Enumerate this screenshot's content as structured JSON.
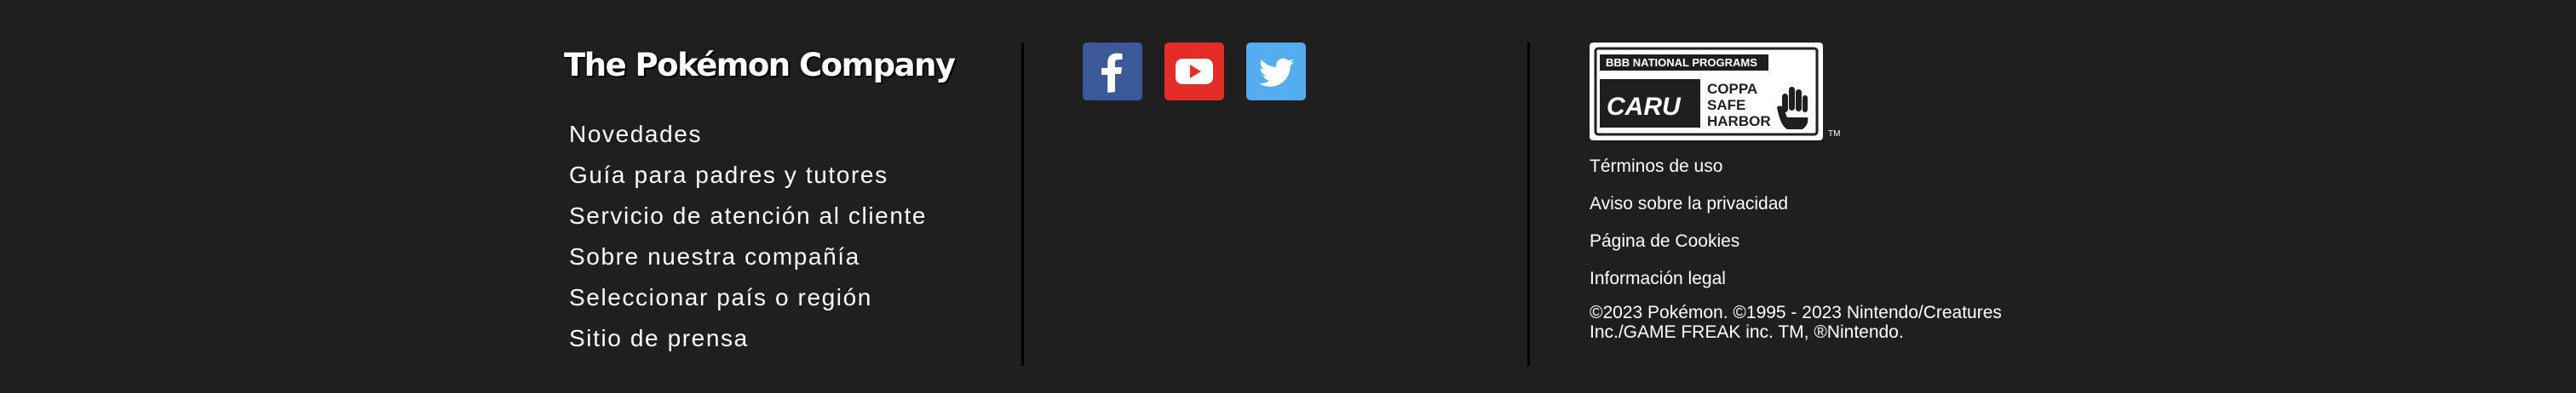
{
  "brand": {
    "name": "The Pokémon Company"
  },
  "nav": {
    "items": [
      "Novedades",
      "Guía para padres y tutores",
      "Servicio de atención al cliente",
      "Sobre nuestra compañía",
      "Seleccionar país o región",
      "Sitio de prensa"
    ]
  },
  "social": {
    "icons": [
      "facebook-icon",
      "youtube-icon",
      "twitter-icon"
    ],
    "colors": {
      "facebook": "#3b5998",
      "youtube": "#e52d27",
      "twitter": "#55acee"
    }
  },
  "badge": {
    "top_text": "BBB NATIONAL PROGRAMS",
    "caru": "CARU",
    "line1": "COPPA",
    "line2": "SAFE",
    "line3": "HARBOR",
    "tm": "TM"
  },
  "legal": {
    "links": [
      "Términos de uso",
      "Aviso sobre la privacidad",
      "Página de Cookies",
      "Información legal"
    ],
    "copyright": "©2023 Pokémon. ©1995 - 2023 Nintendo/Creatures Inc./GAME FREAK inc. TM, ®Nintendo."
  },
  "colors": {
    "background": "#1f1f1f",
    "text": "#ffffff",
    "divider": "#000000"
  }
}
